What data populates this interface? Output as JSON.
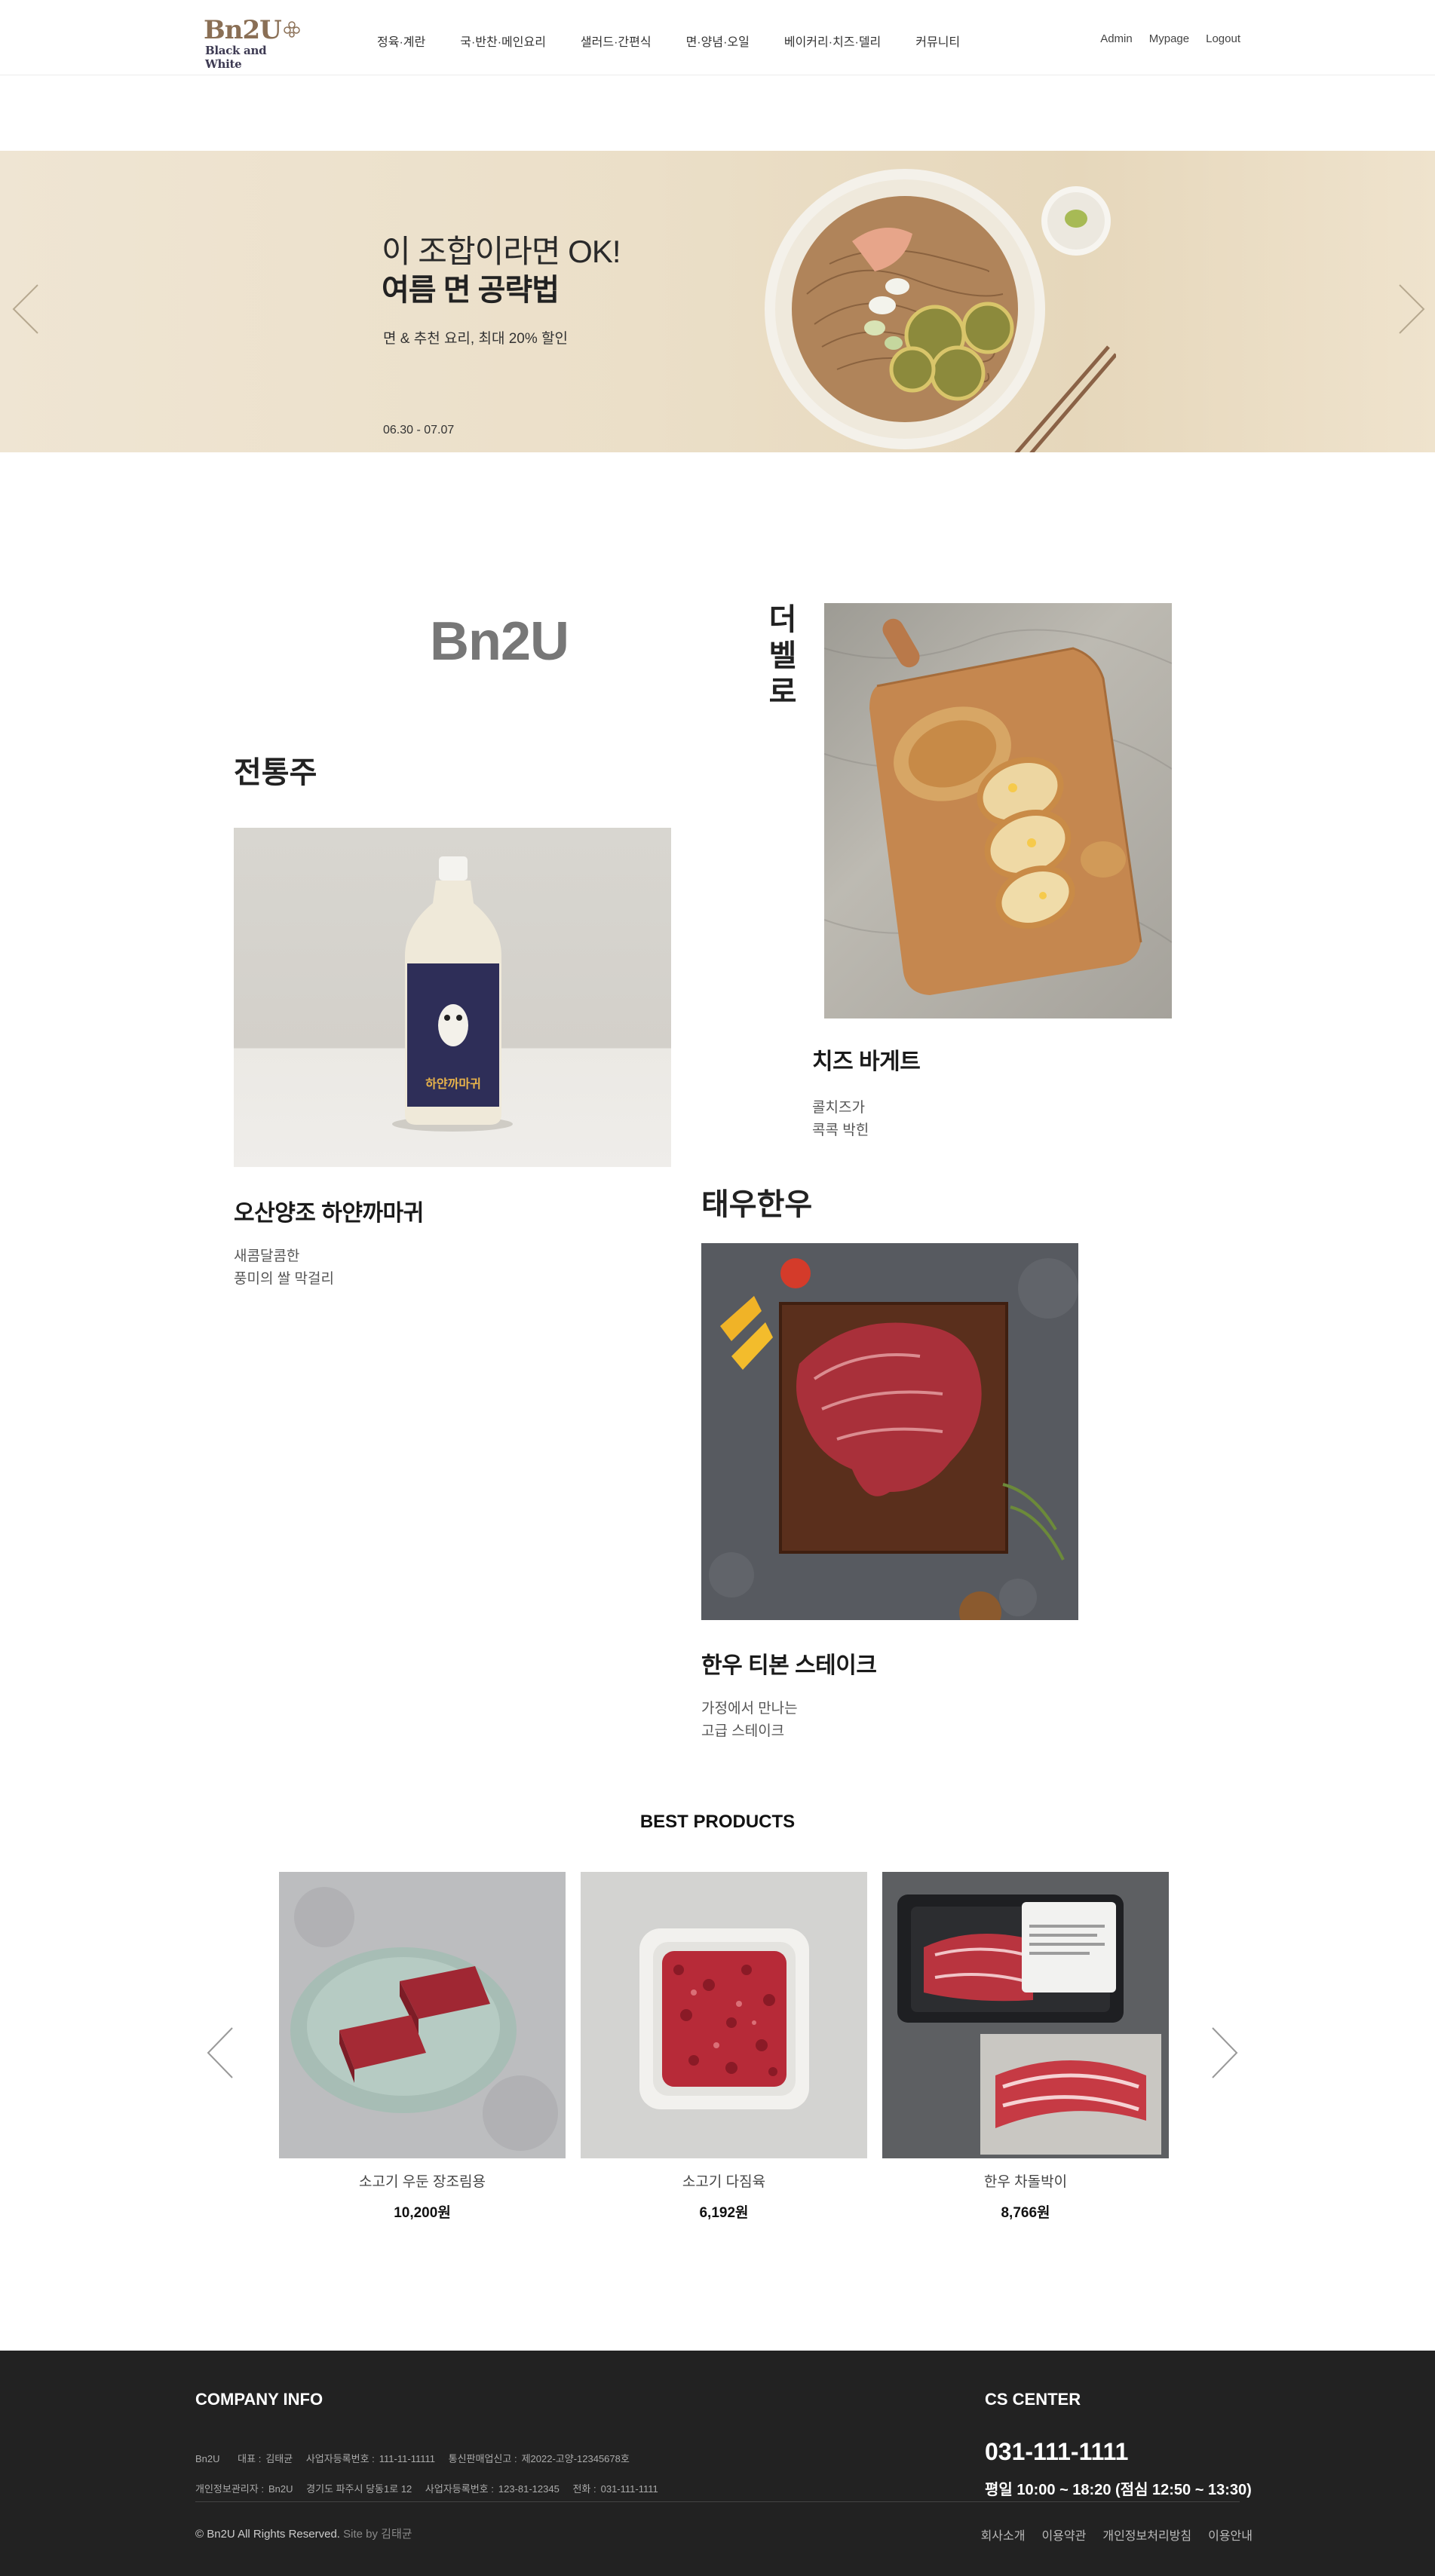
{
  "header": {
    "logo_main": "Bn2U",
    "logo_sub": "Black and White",
    "nav": [
      "정육·계란",
      "국·반찬·메인요리",
      "샐러드·간편식",
      "면·양념·오일",
      "베이커리·치즈·델리",
      "커뮤니티"
    ],
    "util": [
      "Admin",
      "Mypage",
      "Logout"
    ]
  },
  "hero": {
    "subtitle": "이 조합이라면 OK!",
    "title": "여름 면 공략법",
    "desc": "면 & 추천 요리, 최대 20% 할인",
    "date": "06.30 - 07.07"
  },
  "feature": {
    "brand": "Bn2U",
    "categories": {
      "traditional": "전통주",
      "bakery": [
        "더",
        "벨",
        "로"
      ],
      "hanwoo": "태우한우"
    },
    "cards": [
      {
        "name": "오산양조 하얀까마귀",
        "desc": [
          "새콤달콤한",
          "풍미의 쌀 막걸리"
        ],
        "label": "하얀까마귀"
      },
      {
        "name": "치즈 바게트",
        "desc": [
          "콜치즈가",
          "콕콕 박힌"
        ]
      },
      {
        "name": "한우 티본 스테이크",
        "desc": [
          "가정에서 만나는",
          "고급 스테이크"
        ]
      }
    ]
  },
  "best": {
    "title": "BEST PRODUCTS",
    "products": [
      {
        "name": "소고기 우둔 장조림용",
        "price": "10,200원"
      },
      {
        "name": "소고기 다짐육",
        "price": "6,192원"
      },
      {
        "name": "한우 차돌박이",
        "price": "8,766원"
      }
    ]
  },
  "footer": {
    "company_title": "COMPANY INFO",
    "line1": [
      {
        "label": "Bn2U",
        "value": ""
      },
      {
        "label": "대표 :",
        "value": "김태균"
      },
      {
        "label": "사업자등록번호 :",
        "value": "111-11-11111"
      },
      {
        "label": "통신판매업신고 :",
        "value": "제2022-고양-12345678호"
      }
    ],
    "line2": [
      {
        "label": "개인정보관리자 :",
        "value": "Bn2U"
      },
      {
        "label": "",
        "value": "경기도 파주시 당동1로 12"
      },
      {
        "label": "사업자등록번호 :",
        "value": "123-81-12345"
      },
      {
        "label": "전화 :",
        "value": "031-111-1111"
      }
    ],
    "copyright": "© Bn2U All Rights Reserved.",
    "site_by": "Site by 김태균",
    "cs_title": "CS CENTER",
    "phone": "031-111-1111",
    "hours": "평일 10:00 ~ 18:20 (점심 12:50 ~ 13:30)",
    "links": [
      "회사소개",
      "이용약관",
      "개인정보처리방침",
      "이용안내"
    ]
  }
}
